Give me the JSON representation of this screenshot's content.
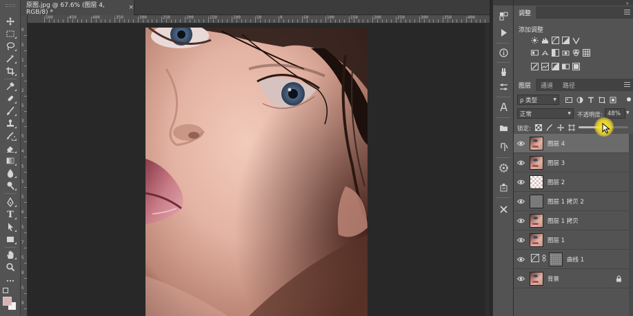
{
  "document": {
    "tab_title": "原图.jpg @ 67.6% (图层 4, RGB/8) *",
    "close_glyph": "×",
    "ruler_top_labels": [
      "500",
      "450",
      "400",
      "350",
      "300",
      "250",
      "200",
      "150",
      "100",
      "50",
      "0",
      "50",
      "100",
      "150",
      "200",
      "250",
      "300",
      "350",
      "400",
      "450",
      "500",
      "550",
      "600",
      "650",
      "700",
      "750",
      "800",
      "850",
      "900",
      "950",
      "1000",
      "1050",
      "1100"
    ],
    "ruler_left_labels": [
      "0",
      "5",
      "1",
      "5",
      "2",
      "5",
      "3",
      "5",
      "4",
      "5",
      "5",
      "5",
      "6",
      "5",
      "7",
      "5",
      "8",
      "5",
      "9",
      "5"
    ]
  },
  "tools": [
    {
      "icon": "move-icon"
    },
    {
      "icon": "marquee-icon"
    },
    {
      "icon": "lasso-icon"
    },
    {
      "icon": "magic-wand-icon"
    },
    {
      "icon": "crop-icon"
    },
    {
      "icon": "eyedropper-icon"
    },
    {
      "icon": "healing-brush-icon"
    },
    {
      "icon": "brush-icon"
    },
    {
      "icon": "clone-stamp-icon"
    },
    {
      "icon": "history-brush-icon"
    },
    {
      "icon": "eraser-icon"
    },
    {
      "icon": "gradient-icon"
    },
    {
      "icon": "blur-icon"
    },
    {
      "icon": "dodge-icon"
    },
    {
      "icon": "pen-icon"
    },
    {
      "icon": "type-tool-icon",
      "glyph": "T"
    },
    {
      "icon": "path-selection-icon"
    },
    {
      "icon": "rectangle-icon"
    },
    {
      "icon": "hand-icon"
    },
    {
      "icon": "zoom-icon"
    }
  ],
  "colors": {
    "foreground": "#d9b3b4",
    "background": "#f2f2f2",
    "selected_layer": "#6b6b6b",
    "cursor_highlight": "#f5e02a"
  },
  "adjustments": {
    "tab_label": "调整",
    "title": "添加调整"
  },
  "layers_panel": {
    "tabs": [
      "图层",
      "通道",
      "路径"
    ],
    "active_tab": 0,
    "kind_filter": "ρ 类型",
    "blend_mode": "正常",
    "opacity_label": "不透明度:",
    "opacity_value": "48%",
    "opacity_fraction": 0.48,
    "lock_label": "锁定:",
    "layers": [
      {
        "name": "图层 4",
        "thumb": "face",
        "selected": true
      },
      {
        "name": "图层 3",
        "thumb": "face",
        "selected": false
      },
      {
        "name": "图层 2",
        "thumb": "checker",
        "selected": false
      },
      {
        "name": "图层 1 拷贝 2",
        "thumb": "gray",
        "selected": false
      },
      {
        "name": "图层 1 拷贝",
        "thumb": "face",
        "selected": false
      },
      {
        "name": "图层 1",
        "thumb": "face",
        "selected": false
      },
      {
        "name": "曲线 1",
        "thumb": "adjustment",
        "selected": false
      },
      {
        "name": "背景",
        "thumb": "face",
        "selected": false,
        "locked": true
      }
    ]
  }
}
